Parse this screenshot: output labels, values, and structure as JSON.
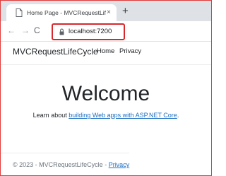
{
  "browser": {
    "tab_title": "Home Page - MVCRequestLifeCyc",
    "tab_close": "×",
    "new_tab": "+",
    "nav": {
      "back": "←",
      "forward": "→",
      "reload": "C"
    },
    "address": "localhost:7200"
  },
  "site": {
    "brand": "MVCRequestLifeCycle",
    "nav_links": [
      "Home",
      "Privacy"
    ],
    "heading": "Welcome",
    "learn_prefix": "Learn about ",
    "learn_link": "building Web apps with ASP.NET Core",
    "learn_suffix": ".",
    "footer_prefix": "© 2023 - MVCRequestLifeCycle - ",
    "footer_link": "Privacy"
  },
  "colors": {
    "highlight_border": "#d8282c",
    "link": "#1b6ec2",
    "tabstrip": "#dee1e6"
  },
  "icons": [
    "page-favicon-icon",
    "lock-icon",
    "back-arrow-icon",
    "forward-arrow-icon",
    "reload-icon",
    "close-icon",
    "plus-icon"
  ]
}
